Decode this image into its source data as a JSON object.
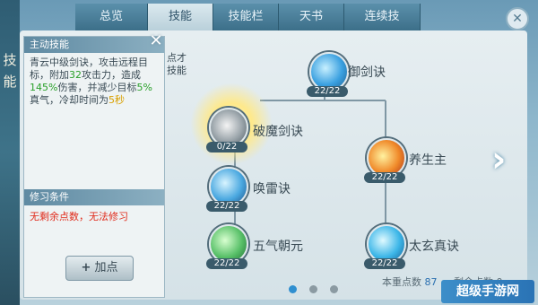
{
  "side_title": "技能",
  "tabs": [
    {
      "label": "总览",
      "active": false
    },
    {
      "label": "技能",
      "active": true
    },
    {
      "label": "技能栏",
      "active": false
    },
    {
      "label": "天书",
      "active": false
    },
    {
      "label": "连续技",
      "active": false
    }
  ],
  "close_glyph": "✕",
  "info": {
    "header": "主动技能",
    "desc_parts": [
      {
        "text": "青云中级剑诀，攻击远程目标，附加",
        "style": ""
      },
      {
        "text": "32",
        "style": "g"
      },
      {
        "text": "攻击力，造成",
        "style": ""
      },
      {
        "text": "145%",
        "style": "g"
      },
      {
        "text": "伤害，并减少目标",
        "style": ""
      },
      {
        "text": "5%",
        "style": "g"
      },
      {
        "text": "真气，冷却时间为",
        "style": ""
      },
      {
        "text": "5秒",
        "style": "y"
      }
    ],
    "condition_header": "修习条件",
    "condition_text": "无剩余点数，无法修习",
    "add_button": "加点",
    "add_plus": "+"
  },
  "hint_text": "点才\n技能",
  "skills": [
    {
      "name": "御剑诀",
      "level": "22/22",
      "icon": "sword-skill-icon"
    },
    {
      "name": "破魔剑诀",
      "level": "0/22",
      "icon": "break-demon-skill-icon"
    },
    {
      "name": "唤雷诀",
      "level": "22/22",
      "icon": "thunder-skill-icon"
    },
    {
      "name": "五气朝元",
      "level": "22/22",
      "icon": "five-qi-skill-icon"
    },
    {
      "name": "养生主",
      "level": "22/22",
      "icon": "nurture-life-skill-icon"
    },
    {
      "name": "太玄真诀",
      "level": "22/22",
      "icon": "taixuan-skill-icon"
    }
  ],
  "next_arrow": "›",
  "pager": {
    "count": 3,
    "active": 0
  },
  "footer": {
    "points_label": "本重点数",
    "points_value": "87",
    "remaining": "剩余点数 0"
  },
  "watermark": "超级手游网",
  "colors": {
    "accent": "#2f8fd0",
    "warning": "#e02a1a",
    "highlight": "#2aa02a"
  }
}
